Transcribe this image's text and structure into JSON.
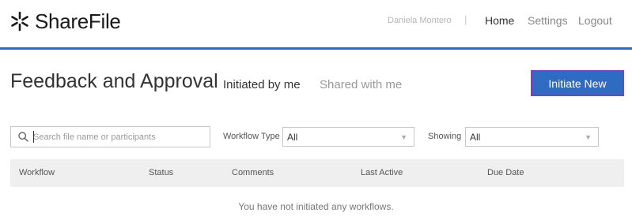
{
  "header": {
    "logo_text": "ShareFile",
    "user_name": "Daniela Montero",
    "separator": "|",
    "nav": {
      "home": "Home",
      "settings": "Settings",
      "logout": "Logout"
    },
    "accent_color": "#2f6bc0"
  },
  "page": {
    "title": "Feedback and Approval",
    "tabs": {
      "initiated": "Initiated by me",
      "shared": "Shared with me"
    },
    "initiate_button": "Initiate New"
  },
  "filters": {
    "search_placeholder": "Search file name or participants",
    "workflow_type_label": "Workflow Type",
    "workflow_type_value": "All",
    "showing_label": "Showing",
    "showing_value": "All"
  },
  "table": {
    "columns": {
      "workflow": "Workflow",
      "status": "Status",
      "comments": "Comments",
      "last_active": "Last Active",
      "due_date": "Due Date"
    },
    "empty_message": "You have not initiated any workflows."
  }
}
